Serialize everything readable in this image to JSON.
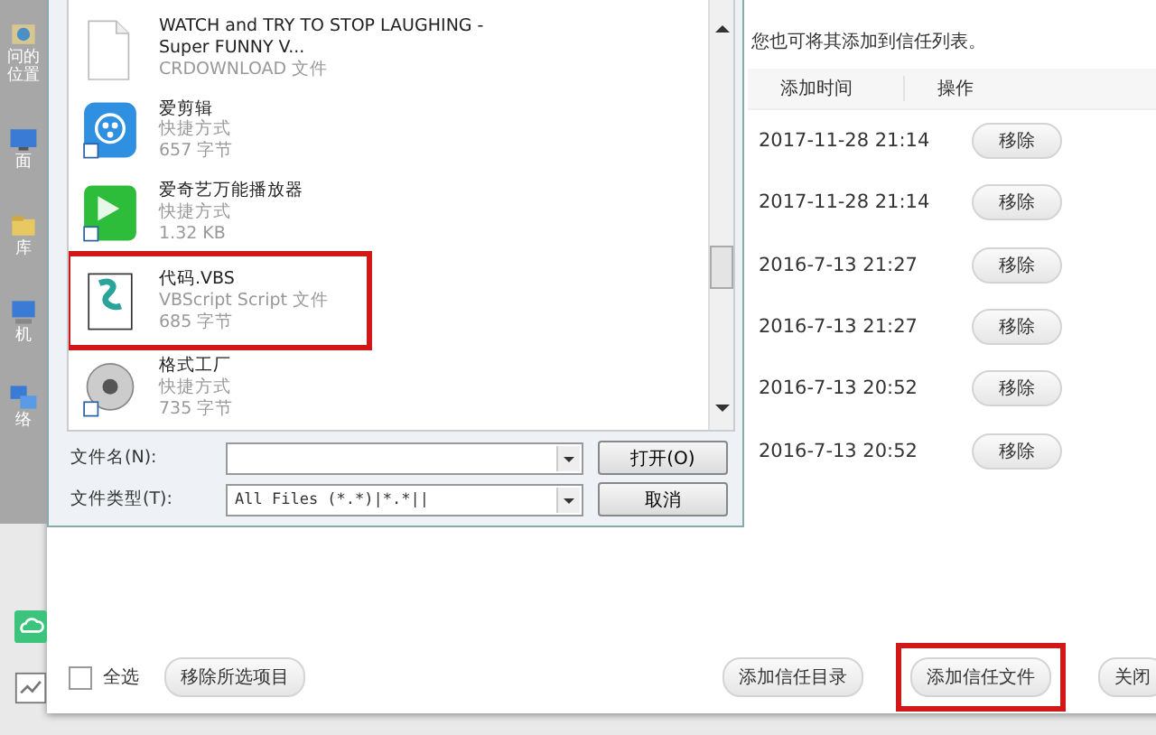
{
  "nav_pane": {
    "items": [
      {
        "label": "问的位置",
        "kind": "recent"
      },
      {
        "label": "面",
        "kind": "desktop"
      },
      {
        "label": "库",
        "kind": "library"
      },
      {
        "label": "机",
        "kind": "computer"
      },
      {
        "label": "络",
        "kind": "network"
      }
    ]
  },
  "file_dialog": {
    "files": [
      {
        "name": "WATCH and TRY TO STOP LAUGHING - Super FUNNY V...",
        "type": "CRDOWNLOAD 文件",
        "kind": "blank",
        "highlighted": false
      },
      {
        "name": "爱剪辑",
        "type": "快捷方式",
        "size": "657 字节",
        "kind": "video",
        "highlighted": false
      },
      {
        "name": "爱奇艺万能播放器",
        "type": "快捷方式",
        "size": "1.32 KB",
        "kind": "player",
        "highlighted": false
      },
      {
        "name": "代码.VBS",
        "type": "VBScript Script 文件",
        "size": "685 字节",
        "kind": "script",
        "highlighted": true
      },
      {
        "name": "格式工厂",
        "type": "快捷方式",
        "size": "735 字节",
        "kind": "disc",
        "highlighted": false
      }
    ],
    "filename_label": "文件名(N):",
    "filetype_label": "文件类型(T):",
    "filetype_value": "All Files (*.*)|*.*||",
    "buttons": [
      "打开(O)",
      "取消"
    ]
  },
  "trust_window": {
    "notice": "您也可将其添加到信任列表。",
    "columns": [
      "添加时间",
      "操作"
    ],
    "rows": [
      {
        "time": "2017-11-28 21:14",
        "action": "移除"
      },
      {
        "time": "2017-11-28 21:14",
        "action": "移除"
      },
      {
        "time": "2016-7-13 21:27",
        "action": "移除"
      },
      {
        "time": "2016-7-13 21:27",
        "action": "移除"
      },
      {
        "time": "2016-7-13 20:52",
        "action": "移除"
      },
      {
        "time": "2016-7-13 20:52",
        "action": "移除"
      }
    ],
    "select_all": {
      "label": "全选",
      "checked": false
    },
    "remove_selected": "移除所选项目",
    "buttons": [
      {
        "label": "添加信任目录",
        "highlighted": false
      },
      {
        "label": "添加信任文件",
        "highlighted": true
      },
      {
        "label": "关闭",
        "highlighted": false
      }
    ]
  }
}
